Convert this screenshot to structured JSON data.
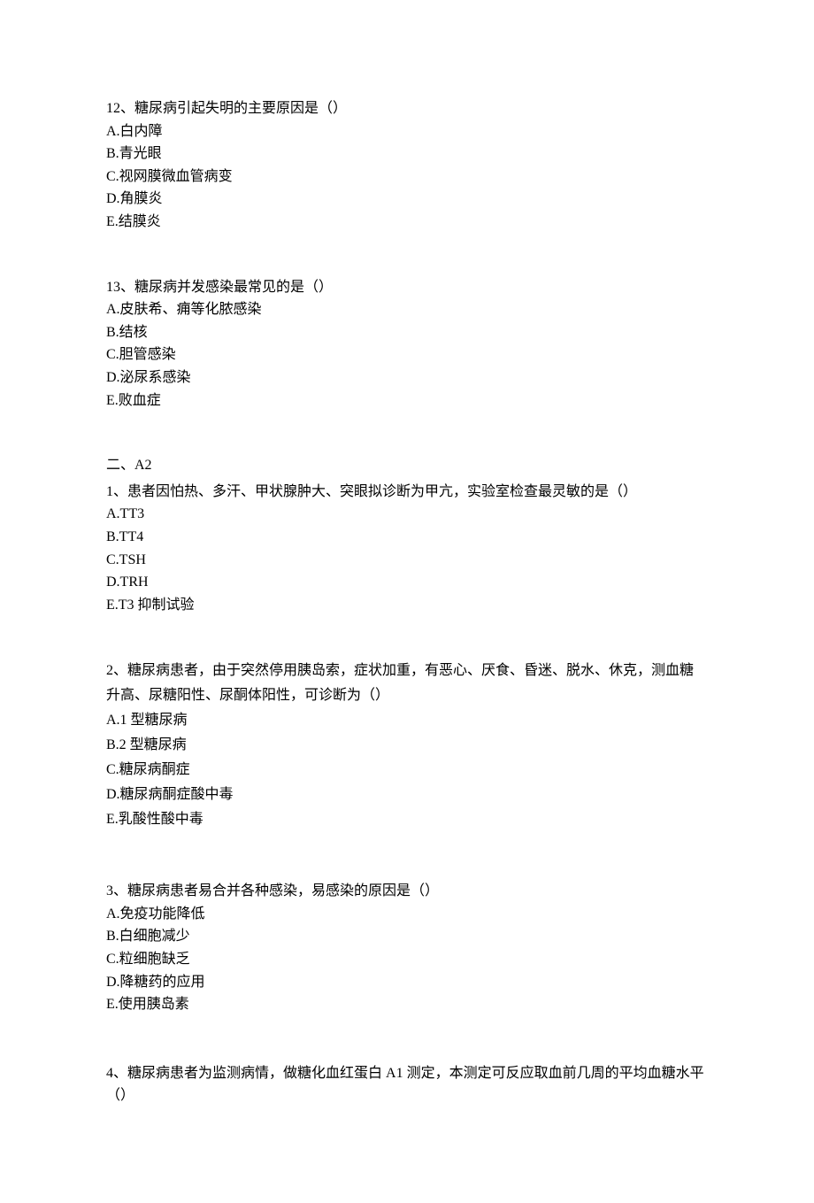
{
  "questions_a": [
    {
      "number": "12",
      "stem": "糖尿病引起失明的主要原因是（）",
      "options": [
        "A.白内障",
        "B.青光眼",
        "C.视网膜微血管病变",
        "D.角膜炎",
        "E.结膜炎"
      ]
    },
    {
      "number": "13",
      "stem": "糖尿病并发感染最常见的是（）",
      "options": [
        "A.皮肤希、痈等化脓感染",
        "B.结核",
        "C.胆管感染",
        "D.泌尿系感染",
        "E.败血症"
      ]
    }
  ],
  "section_b_title": "二、A2",
  "questions_b": [
    {
      "number": "1",
      "stem": "患者因怕热、多汗、甲状腺肿大、突眼拟诊断为甲亢，实验室检查最灵敏的是（）",
      "options": [
        "A.TT3",
        "B.TT4",
        "C.TSH",
        "D.TRH",
        "E.T3 抑制试验"
      ]
    },
    {
      "number": "2",
      "stem": "糖尿病患者，由于突然停用胰岛索，症状加重，有恶心、厌食、昏迷、脱水、休克，测血糖升高、尿糖阳性、尿酮体阳性，可诊断为（）",
      "options": [
        "A.1 型糖尿病",
        "B.2 型糖尿病",
        "C.糖尿病酮症",
        "D.糖尿病酮症酸中毒",
        "E.乳酸性酸中毒"
      ]
    },
    {
      "number": "3",
      "stem": "糖尿病患者易合并各种感染，易感染的原因是（）",
      "options": [
        "A.免疫功能降低",
        "B.白细胞减少",
        "C.粒细胞缺乏",
        "D.降糖药的应用",
        "E.使用胰岛素"
      ]
    },
    {
      "number": "4",
      "stem": "糖尿病患者为监测病情，做糖化血红蛋白 A1 测定，本测定可反应取血前几周的平均血糖水平（）",
      "options": []
    }
  ]
}
